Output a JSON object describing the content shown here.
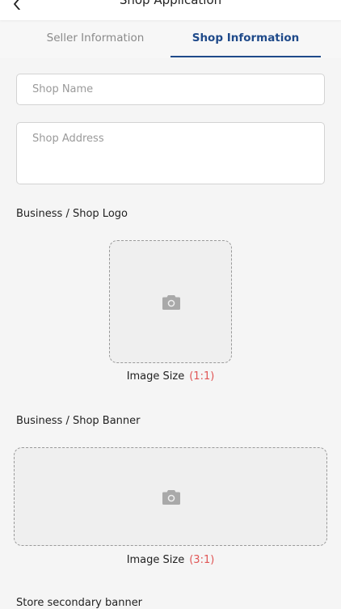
{
  "header": {
    "title": "Shop Application",
    "back_icon": "chevron-left-icon"
  },
  "tabs": [
    {
      "label": "Seller Information",
      "active": false
    },
    {
      "label": "Shop Information",
      "active": true
    }
  ],
  "form": {
    "shop_name_placeholder": "Shop Name",
    "shop_address_placeholder": "Shop Address"
  },
  "logo_section": {
    "label": "Business / Shop Logo",
    "icon": "camera-icon",
    "size_label": "Image Size",
    "size_ratio": "(1:1)"
  },
  "banner_section": {
    "label": "Business / Shop Banner",
    "icon": "camera-icon",
    "size_label": "Image Size",
    "size_ratio": "(3:1)"
  },
  "secondary_banner_section": {
    "label": "Store secondary banner"
  },
  "colors": {
    "accent": "#1f4a8a",
    "ratio": "#e05555",
    "background": "#f5f5f5"
  }
}
